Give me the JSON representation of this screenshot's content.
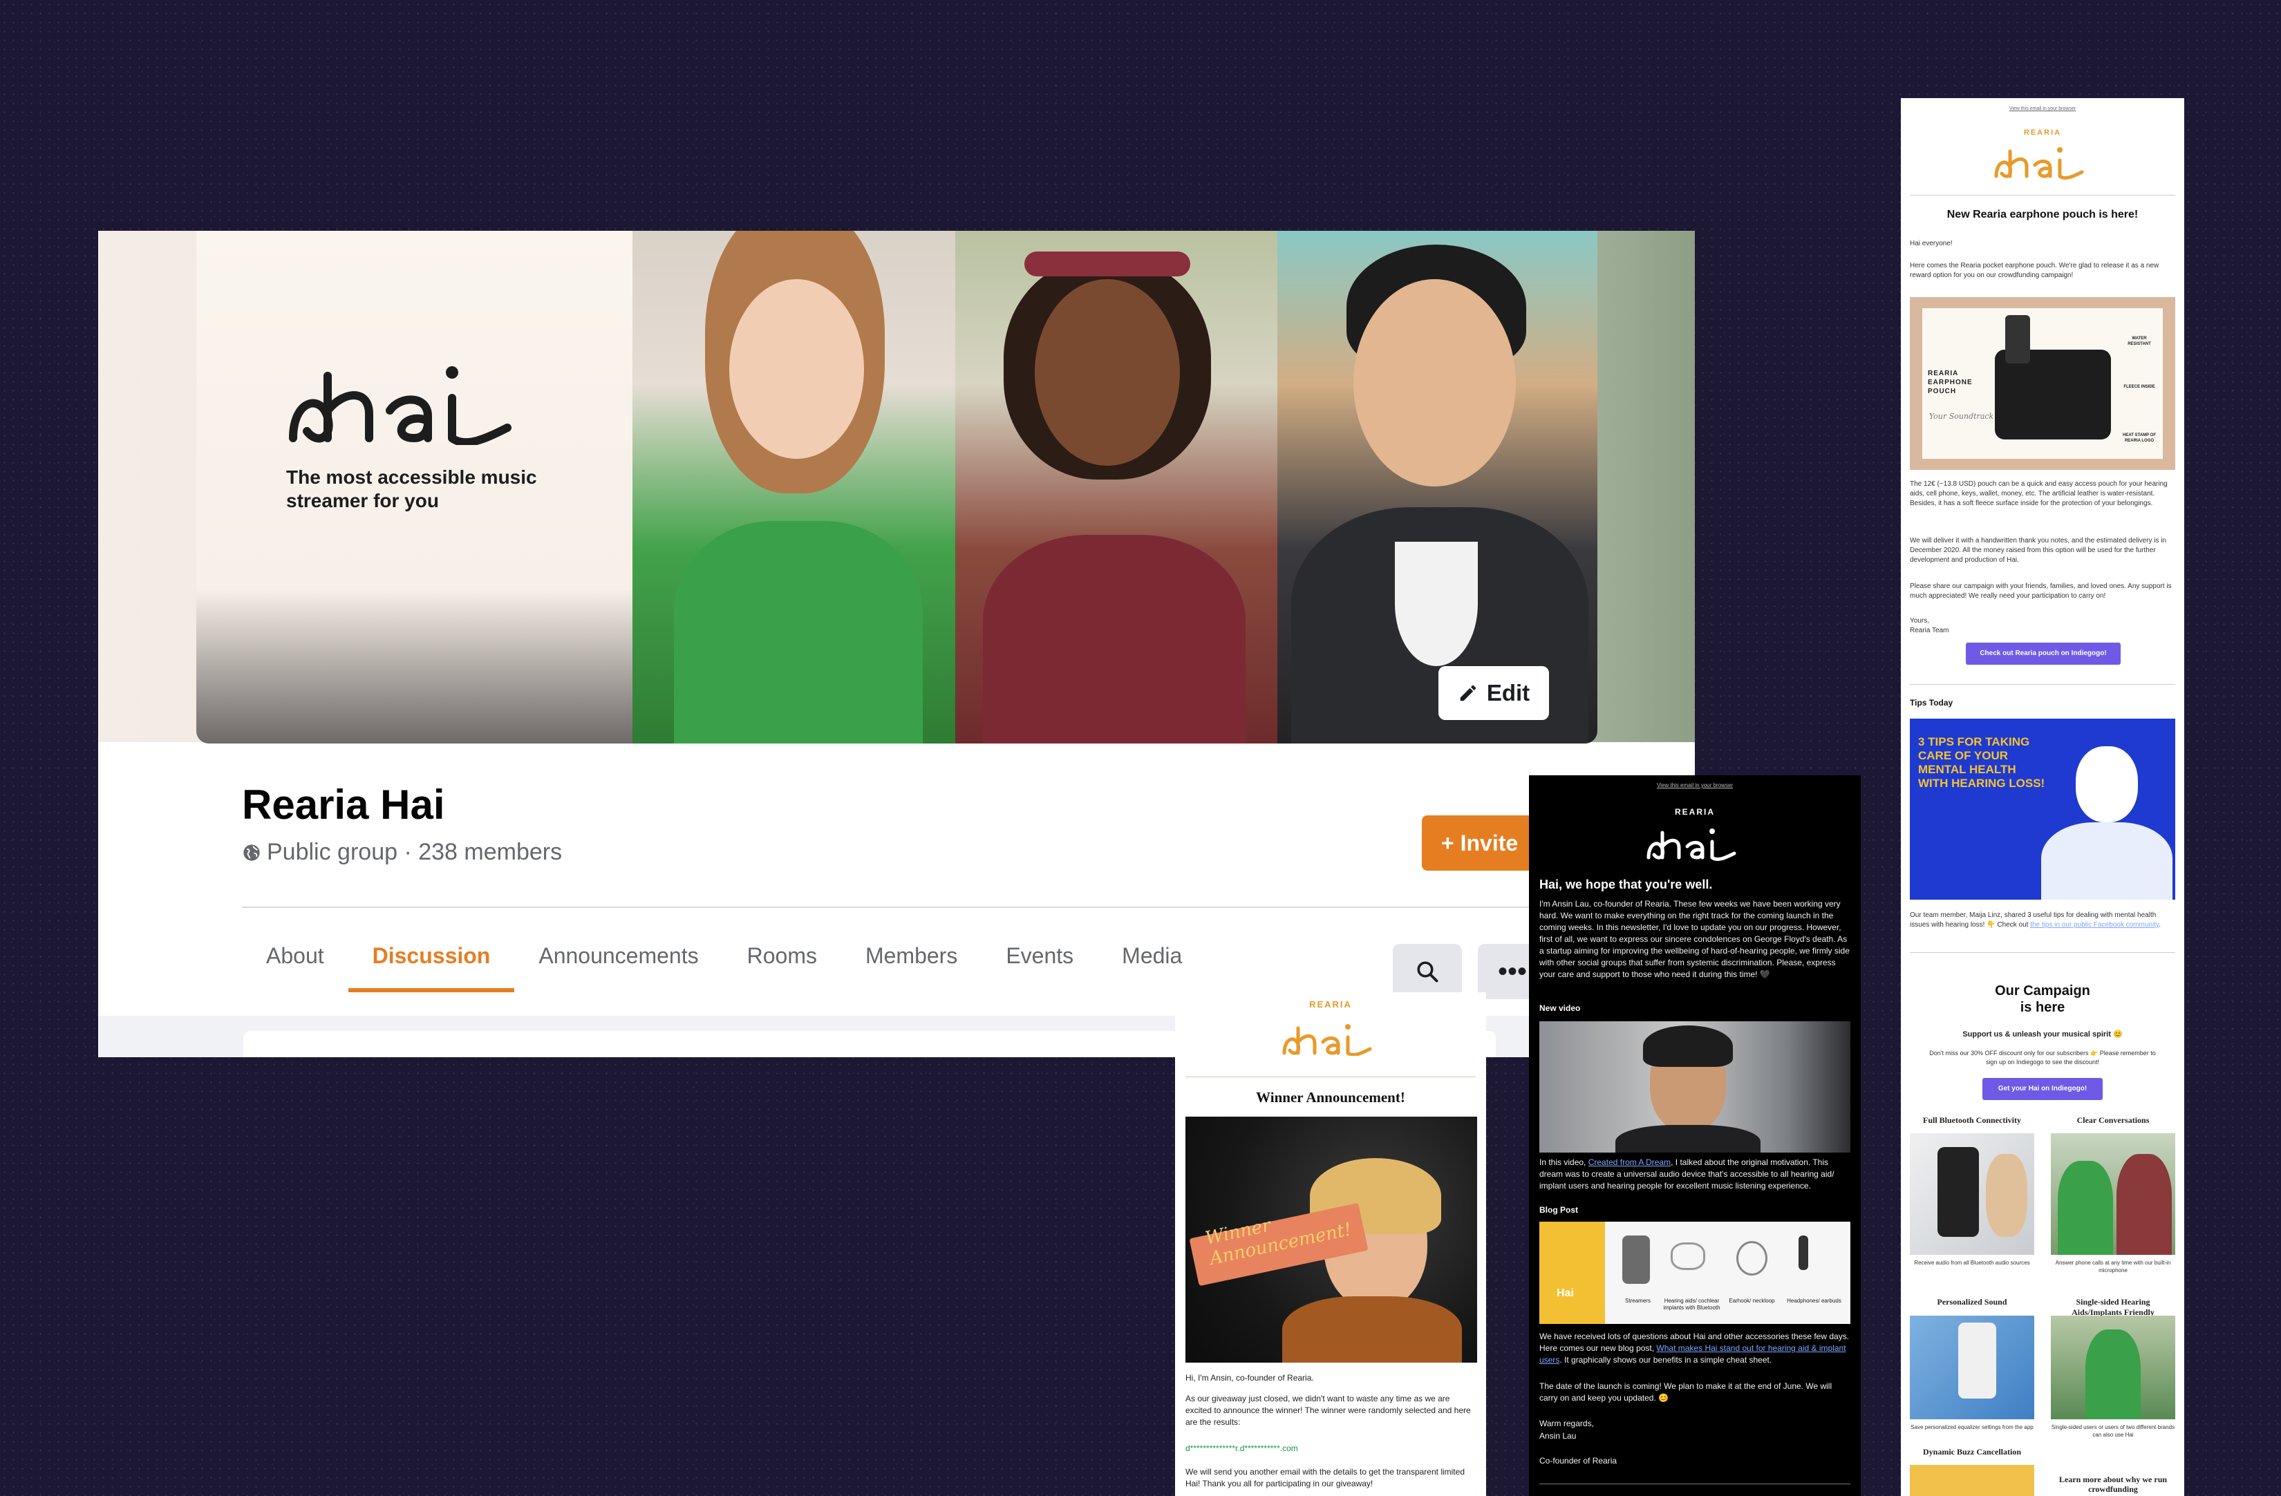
{
  "colors": {
    "accent": "#e57e21",
    "hai_orange": "#e89a2a",
    "email_button": "#6e5ae6",
    "background": "#1c1733"
  },
  "facebook": {
    "cover": {
      "brand_tagline": "The most accessible music streamer for you",
      "edit_label": "Edit"
    },
    "group_name": "Rearia Hai",
    "group_meta": "Public group · 238 members",
    "invite_label": "+ Invite",
    "tabs": [
      "About",
      "Discussion",
      "Announcements",
      "Rooms",
      "Members",
      "Events",
      "Media"
    ],
    "active_tab": "Discussion",
    "icons": [
      "globe-icon",
      "pencil-icon",
      "search-icon",
      "more-icon"
    ]
  },
  "email_winner": {
    "brand_top": "REARIA",
    "title": "Winner Announcement!",
    "hero_text_1": "Winner",
    "hero_text_2": "Announcement!",
    "greeting": "Hi, I'm Ansin, co-founder of Rearia.",
    "body": "As our giveaway just closed, we didn't want to waste any time as we are excited to announce the winner! The winner were randomly selected and here are the results:",
    "winner_email": "d**************r.d***********.com",
    "closing": "We will send you another email with the details to get the transparent limited Hai! Thank you all for participating in our giveaway!"
  },
  "email_newsletter": {
    "view_link": "View this email in your browser",
    "brand_top": "REARIA",
    "headline": "Hai, we hope that you're well.",
    "intro": "I'm Ansin Lau, co-founder of Rearia. These few weeks we have been working very hard. We want to make everything on the right track for the coming launch in the coming weeks. In this newsletter, I'd love to update you on our progress. However, first of all, we want to express our sincere condolences on George Floyd's death. As a startup aiming for improving the wellbeing of hard-of-hearing people, we firmly side with other social groups that suffer from systemic discrimination. Please, express your care and support to those who need it during this time! 🖤",
    "video_heading": "New video",
    "video_text_pre": "In this video, ",
    "video_link": "Created from A Dream",
    "video_text_post": ", I talked about the original motivation. This dream was to create a universal audio device that's accessible to all hearing aid/ implant users and hearing people for excellent music listening experience.",
    "blog_heading": "Blog Post",
    "blog_items": [
      {
        "label": "Streamers"
      },
      {
        "label": "Hearing aids/ cochlear implants with Bluetooth"
      },
      {
        "label": "Earhook/ neckloop"
      },
      {
        "label": "Headphones/ earbuds"
      }
    ],
    "blog_text_pre": "We have received lots of questions about Hai and other accessories these few days. Here comes our new blog post, ",
    "blog_link": "What makes Hai stand out for hearing aid & implant users",
    "blog_text_post": ". It graphically shows our benefits in a simple cheat sheet.",
    "launch_text": "The date of the launch is coming! We plan to make it at the end of June. We will carry on and keep you updated. 😊",
    "regards": "Warm regards,",
    "signer": "Ansin Lau",
    "signer_title": "Co-founder of Rearia"
  },
  "email_pouch": {
    "view_link": "View this email in your browser",
    "brand_top": "REARIA",
    "title": "New Rearia earphone pouch is here!",
    "greeting": "Hai everyone!",
    "intro": "Here comes the Rearia pocket earphone pouch. We're glad to release it as a new reward option for you on our crowdfunding campaign!",
    "pouch_label": "REARIA EARPHONE POUCH",
    "pouch_script": "Your Soundtrack",
    "pouch_features": [
      "WATER RESISTANT",
      "FLEECE INSIDE",
      "HEAT STAMP OF REARIA LOGO"
    ],
    "p1": "The 12€ (~13.8 USD) pouch can be a quick and easy access pouch for your hearing aids, cell phone, keys, wallet, money, etc. The artificial leather is water-resistant. Besides, it has a soft fleece surface inside for the protection of your belongings.",
    "p2": "We will deliver it with a handwritten thank you notes, and the estimated delivery is in December 2020. All the money raised from this option will be used for the further development and production of Hai.",
    "p3": "Please share our campaign with your friends, families, and loved ones. Any support is much appreciated! We really need your participation to carry on!",
    "sign1": "Yours,",
    "sign2": "Rearia Team",
    "cta": "Check out Rearia pouch on Indiegogo!",
    "tips_heading": "Tips Today",
    "tips_banner": "3 TIPS FOR TAKING CARE OF YOUR MENTAL HEALTH WITH HEARING LOSS!",
    "tips_text_pre": "Our team member, Maija Linz, shared 3 useful tips for dealing with mental health issues with hearing loss! 👇 Check out ",
    "tips_link": "the tips in our public Facebook community",
    "tips_text_post": ".",
    "campaign_title_1": "Our Campaign",
    "campaign_title_2": "is here",
    "campaign_sub": "Support us & unleash your musical spirit 😊",
    "campaign_text": "Don't miss our 30% OFF discount only for our subscribers 👉 Please remember to sign up on Indiegogo to see the discount!",
    "campaign_cta": "Get your Hai on Indiegogo!",
    "features": [
      {
        "title": "Full Bluetooth Connectivity",
        "caption": "Receive audio from all Bluetooth audio sources"
      },
      {
        "title": "Clear Conversations",
        "caption": "Answer phone calls at any time with our built-in microphone"
      },
      {
        "title": "Personalized Sound",
        "caption": "Save personalized equalizer settings from the app"
      },
      {
        "title": "Single-sided Hearing Aids/Implants Friendly",
        "caption": "Single-sided users or users of two different brands can also use Hai"
      }
    ],
    "bottom_left": "Dynamic Buzz Cancellation",
    "bottom_right": "Learn more about why we run crowdfunding"
  }
}
